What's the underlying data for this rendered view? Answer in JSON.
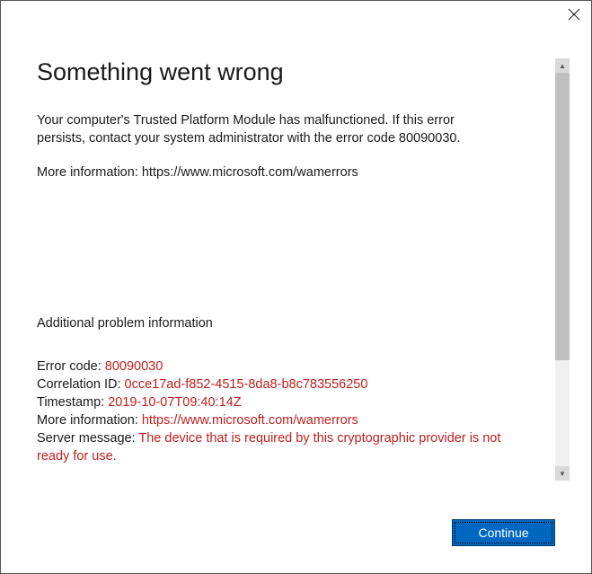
{
  "title": "Something went wrong",
  "message_paragraph": "Your computer's Trusted Platform Module has malfunctioned. If this error persists, contact your system administrator with the error code 80090030.",
  "more_info_prefix": "More information: ",
  "more_info_url": "https://www.microsoft.com/wamerrors",
  "additional_header": "Additional problem information",
  "details": {
    "error_code_label": "Error code: ",
    "error_code": "80090030",
    "correlation_label": "Correlation ID: ",
    "correlation_id": "0cce17ad-f852-4515-8da8-b8c783556250",
    "timestamp_label": "Timestamp: ",
    "timestamp": "2019-10-07T09:40:14Z",
    "more_info_label": "More information: ",
    "more_info_url": "https://www.microsoft.com/wamerrors",
    "server_msg_label": "Server message: ",
    "server_msg": "The device that is required by this cryptographic provider is not ready for use."
  },
  "continue_label": "Continue"
}
